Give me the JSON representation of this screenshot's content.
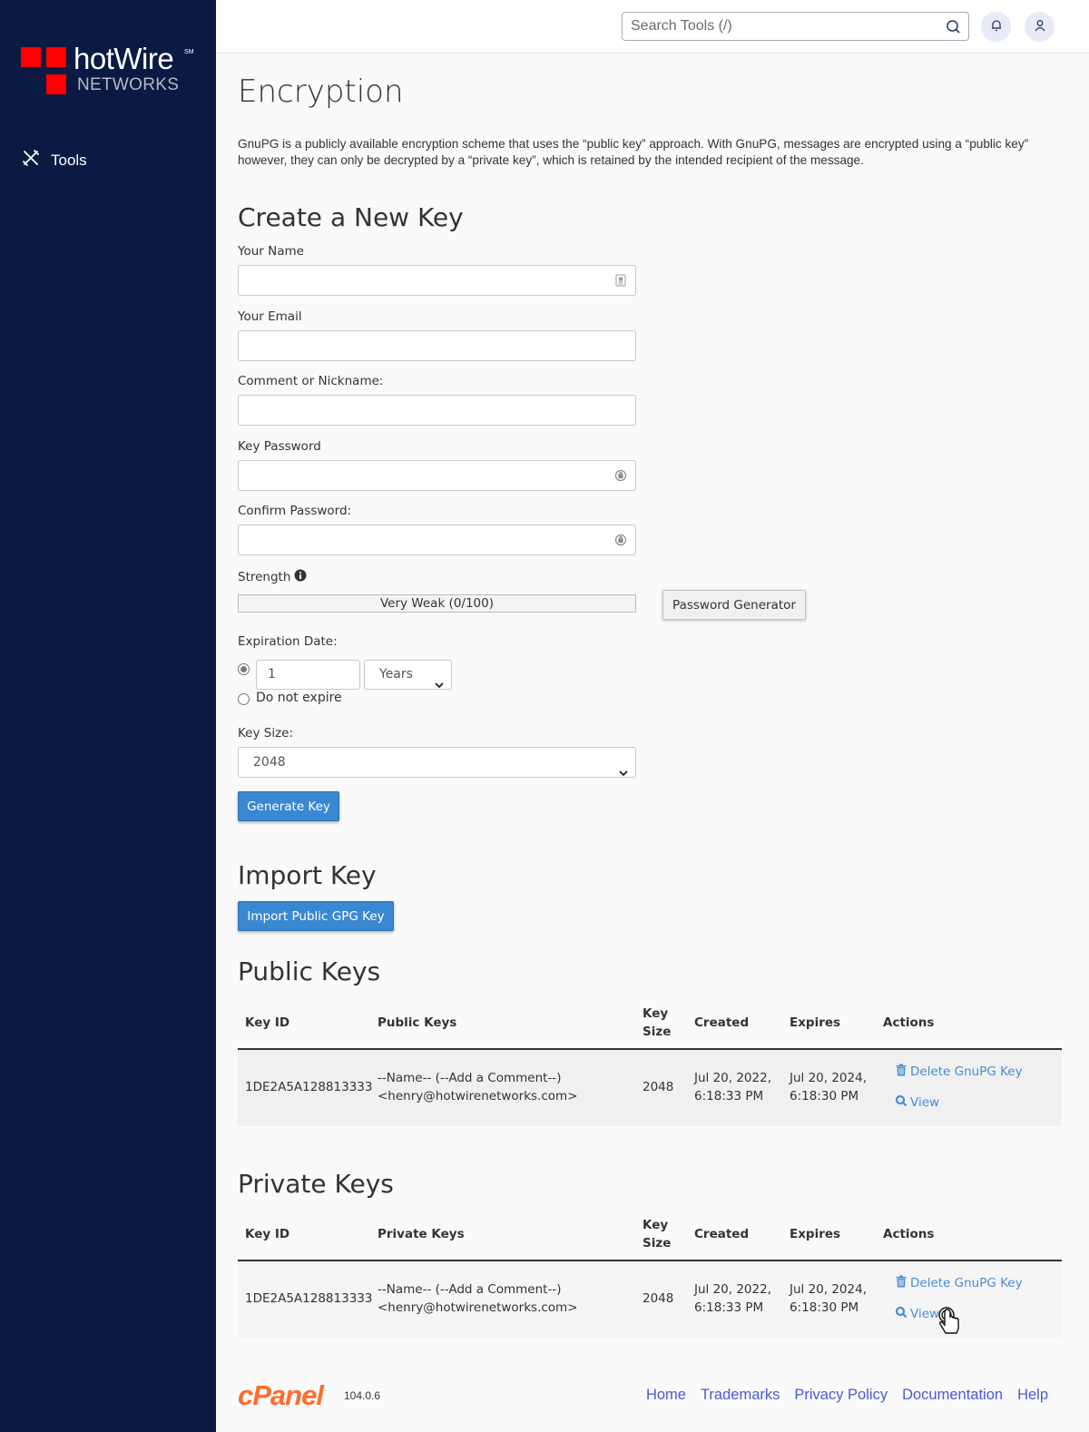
{
  "brand": {
    "name": "hotWire",
    "mark": "SM",
    "sub": "NETWORKS",
    "colors": {
      "sidebar": "#0b1a43",
      "logo_red": "#ff0000",
      "accent_blue": "#3a88d2",
      "link_blue": "#4a8bd6",
      "cpanel_orange": "#ff6c2c"
    }
  },
  "sidebar": {
    "items": [
      {
        "label": "Tools",
        "icon": "tools-icon"
      }
    ]
  },
  "topbar": {
    "search_placeholder": "Search Tools (/)",
    "search_icon": "search-icon",
    "notifications_icon": "bell-icon",
    "user_icon": "user-icon"
  },
  "page": {
    "title": "Encryption",
    "intro": "GnuPG is a publicly available encryption scheme that uses the “public key” approach. With GnuPG, messages are encrypted using a “public key” however, they can only be decrypted by a “private key”, which is retained by the intended recipient of the message."
  },
  "create": {
    "heading": "Create a New Key",
    "name_label": "Your Name",
    "name_value": "",
    "email_label": "Your Email",
    "email_value": "",
    "comment_label": "Comment or Nickname:",
    "comment_value": "",
    "password_label": "Key Password",
    "password_value": "",
    "confirm_label": "Confirm Password:",
    "confirm_value": "",
    "strength_label": "Strength",
    "strength_text": "Very Weak (0/100)",
    "strength_value": 0,
    "password_generator_label": "Password Generator",
    "expiration_label": "Expiration Date:",
    "expiration_amount": "1",
    "expiration_unit": "Years",
    "expiration_mode": "amount",
    "do_not_expire_label": "Do not expire",
    "key_size_label": "Key Size:",
    "key_size_value": "2048",
    "generate_label": "Generate Key"
  },
  "import": {
    "heading": "Import Key",
    "button_label": "Import Public GPG Key"
  },
  "public_keys": {
    "heading": "Public Keys",
    "columns": [
      "Key ID",
      "Public Keys",
      "Key Size",
      "Created",
      "Expires",
      "Actions"
    ],
    "column_key_size_line1": "Key",
    "column_key_size_line2": "Size",
    "rows": [
      {
        "key_id": "1DE2A5A128813333",
        "key_line1": "--Name-- (--Add a Comment--)",
        "key_line2": "<henry@hotwirenetworks.com>",
        "size": "2048",
        "created_date": "Jul 20, 2022,",
        "created_time": "6:18:33 PM",
        "expires_date": "Jul 20, 2024,",
        "expires_time": "6:18:30 PM",
        "delete_label": "Delete GnuPG Key",
        "view_label": "View"
      }
    ]
  },
  "private_keys": {
    "heading": "Private Keys",
    "columns": [
      "Key ID",
      "Private Keys",
      "Key Size",
      "Created",
      "Expires",
      "Actions"
    ],
    "column_key_size_line1": "Key",
    "column_key_size_line2": "Size",
    "rows": [
      {
        "key_id": "1DE2A5A128813333",
        "key_line1": "--Name-- (--Add a Comment--)",
        "key_line2": "<henry@hotwirenetworks.com>",
        "size": "2048",
        "created_date": "Jul 20, 2022,",
        "created_time": "6:18:33 PM",
        "expires_date": "Jul 20, 2024,",
        "expires_time": "6:18:30 PM",
        "delete_label": "Delete GnuPG Key",
        "view_label": "View"
      }
    ]
  },
  "footer": {
    "logo": "cPanel",
    "version": "104.0.6",
    "links": [
      "Home",
      "Trademarks",
      "Privacy Policy",
      "Documentation",
      "Help"
    ]
  }
}
